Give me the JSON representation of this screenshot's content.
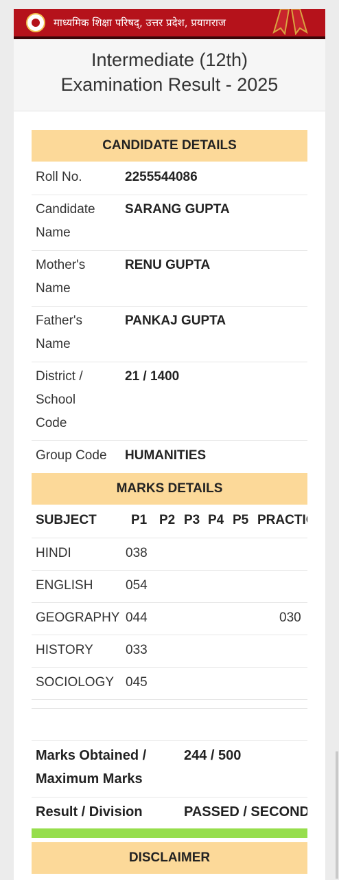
{
  "header": {
    "board_name": "माध्यमिक शिक्षा परिषद्, उत्तर प्रदेश, प्रयागराज"
  },
  "title": {
    "line1": "Intermediate (12th)",
    "line2": "Examination Result - 2025"
  },
  "candidate": {
    "heading": "CANDIDATE DETAILS",
    "roll": {
      "label": "Roll No.",
      "value": "2255544086"
    },
    "name": {
      "label1": "Candidate",
      "label2": "Name",
      "value": "SARANG GUPTA"
    },
    "mother": {
      "label1": "Mother's",
      "label2": "Name",
      "value": "RENU GUPTA"
    },
    "father": {
      "label1": "Father's",
      "label2": "Name",
      "value": "PANKAJ GUPTA"
    },
    "district": {
      "label1": "District /",
      "label2": "School",
      "label3": "Code",
      "value": "21 / 1400"
    },
    "group": {
      "label": "Group Code",
      "value": "HUMANITIES"
    }
  },
  "marks": {
    "heading": "MARKS DETAILS",
    "columns": {
      "subject": "SUBJECT",
      "p1": "P1",
      "p2": "P2",
      "p3": "P3",
      "p4": "P4",
      "p5": "P5",
      "practical": "PRACTIC"
    },
    "rows": [
      {
        "subject": "HINDI",
        "p1": "038",
        "practical": ""
      },
      {
        "subject": "ENGLISH",
        "p1": "054",
        "practical": ""
      },
      {
        "subject": "GEOGRAPHY",
        "p1": "044",
        "practical": "030"
      },
      {
        "subject": "HISTORY",
        "p1": "033",
        "practical": ""
      },
      {
        "subject": "SOCIOLOGY",
        "p1": "045",
        "practical": ""
      }
    ]
  },
  "summary": {
    "marks_label1": "Marks Obtained /",
    "marks_label2": "Maximum Marks",
    "marks_value": "244 / 500",
    "result_label": "Result / Division",
    "result_value": "PASSED / SECOND I"
  },
  "disclaimer": {
    "heading": "DISCLAIMER"
  },
  "colors": {
    "header": "#b5121b",
    "band": "#fcd999",
    "pass_bar": "#96de4c"
  }
}
